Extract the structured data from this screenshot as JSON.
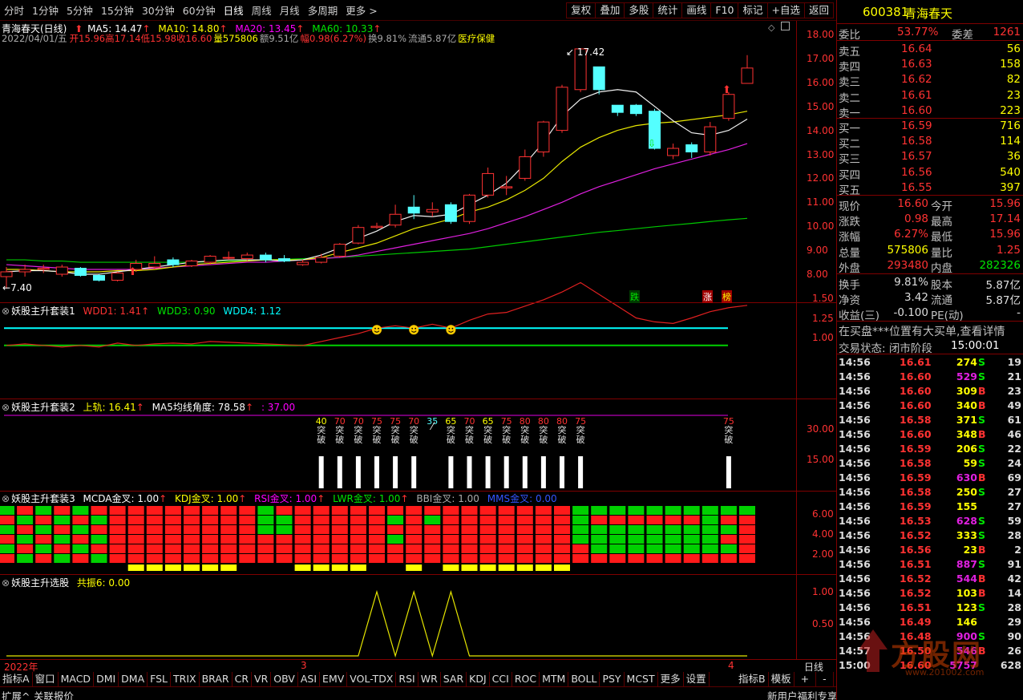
{
  "topbar": {
    "periods": [
      "分时",
      "1分钟",
      "5分钟",
      "15分钟",
      "30分钟",
      "60分钟",
      "日线",
      "周线",
      "月线",
      "多周期",
      "更多"
    ],
    "active_period": "日线",
    "more_arrow": "chevron-right-icon",
    "tools": [
      "复权",
      "叠加",
      "多股",
      "统计",
      "画线",
      "F10",
      "标记",
      "+自选",
      "返回"
    ]
  },
  "stock": {
    "code": "600381",
    "name": "青海春天"
  },
  "main_chart": {
    "title": "青海春天(日线)",
    "ma5": "MA5: 14.47",
    "ma10": "MA10: 14.80",
    "ma20": "MA20: 13.45",
    "ma60": "MA60: 10.33",
    "date": "2022/04/01/五",
    "open_l": "开",
    "open": "15.96",
    "high_l": "高",
    "high": "17.14",
    "low_l": "低",
    "low": "15.98",
    "close_l": "收",
    "close": "16.60",
    "vol_l": "量",
    "vol": "575806",
    "amt": "额9.51亿",
    "amp_l": "幅",
    "amp": "0.98(6.27%)",
    "turn": "换9.81%",
    "circ": "流通5.87亿",
    "sector": "医疗保健",
    "y_ticks": [
      "18.00",
      "17.00",
      "16.00",
      "15.00",
      "14.00",
      "13.00",
      "12.00",
      "11.00",
      "10.00",
      "9.00",
      "8.00"
    ],
    "max_label": "17.42",
    "min_label": "7.40",
    "tag_down": "跌",
    "tag_up": "涨",
    "tag_rank": "榜"
  },
  "panel1": {
    "title": "妖股主升套装1",
    "wdd1": "WDD1: 1.41",
    "wdd3": "WDD3: 0.90",
    "wdd4": "WDD4: 1.12",
    "y_ticks": [
      "1.50",
      "1.25",
      "1.00"
    ]
  },
  "panel2": {
    "title": "妖股主升套装2",
    "upper": "上轨: 16.41",
    "ma5_angle": "MA5均线角度: 78.58",
    "val": ": 37.00",
    "y_ticks": [
      "30.00",
      "15.00"
    ],
    "signals": [
      "40",
      "70",
      "70",
      "75",
      "75",
      "70",
      "35",
      "65",
      "70",
      "65",
      "75",
      "80",
      "80",
      "80",
      "75",
      "75"
    ],
    "break_word": "突破"
  },
  "panel3": {
    "title": "妖股主升套装3",
    "mcda": "MCDA金叉: 1.00",
    "kdj": "KDJ金叉: 1.00",
    "rsi": "RSI金叉: 1.00",
    "lwr": "LWR金叉: 1.00",
    "bbi": "BBI金叉: 1.00",
    "mms": "MMS金叉: 0.00",
    "y_ticks": [
      "6.00",
      "4.00",
      "2.00"
    ]
  },
  "panel4": {
    "title": "妖股主升选股",
    "resonance": "共振6: 0.00",
    "y_ticks": [
      "1.00",
      "0.50"
    ]
  },
  "xaxis": {
    "year": "2022年",
    "m3": "3",
    "m4": "4",
    "period": "日线"
  },
  "bottom_tabs": [
    "指标A",
    "窗口",
    "MACD",
    "DMI",
    "DMA",
    "FSL",
    "TRIX",
    "BRAR",
    "CR",
    "VR",
    "OBV",
    "ASI",
    "EMV",
    "VOL-TDX",
    "RSI",
    "WR",
    "SAR",
    "KDJ",
    "CCI",
    "ROC",
    "MTM",
    "BOLL",
    "PSY",
    "MCST",
    "更多",
    "设置"
  ],
  "bottom_right": [
    "指标B",
    "模板",
    "+",
    "-"
  ],
  "status": {
    "expand": "扩展^",
    "news": "关联报价",
    "promo": "新用户福利专享",
    "tabs": [
      "笔",
      "价",
      "细",
      "势",
      "联",
      "值",
      "主",
      "筹"
    ]
  },
  "orderbook": {
    "wb_l": "委比",
    "wb": "53.77%",
    "wc_l": "委差",
    "wc": "1261",
    "asks": [
      {
        "l": "卖五",
        "p": "16.64",
        "v": "56"
      },
      {
        "l": "卖四",
        "p": "16.63",
        "v": "158"
      },
      {
        "l": "卖三",
        "p": "16.62",
        "v": "82"
      },
      {
        "l": "卖二",
        "p": "16.61",
        "v": "23"
      },
      {
        "l": "卖一",
        "p": "16.60",
        "v": "223"
      }
    ],
    "bids": [
      {
        "l": "买一",
        "p": "16.59",
        "v": "716"
      },
      {
        "l": "买二",
        "p": "16.58",
        "v": "114"
      },
      {
        "l": "买三",
        "p": "16.57",
        "v": "36"
      },
      {
        "l": "买四",
        "p": "16.56",
        "v": "540"
      },
      {
        "l": "买五",
        "p": "16.55",
        "v": "397"
      }
    ]
  },
  "quote": [
    {
      "l1": "现价",
      "v1": "16.60",
      "l2": "今开",
      "v2": "15.96"
    },
    {
      "l1": "涨跌",
      "v1": "0.98",
      "l2": "最高",
      "v2": "17.14"
    },
    {
      "l1": "涨幅",
      "v1": "6.27%",
      "l2": "最低",
      "v2": "15.96"
    },
    {
      "l1": "总量",
      "v1": "575806",
      "l2": "量比",
      "v2": "1.25"
    },
    {
      "l1": "外盘",
      "v1": "293480",
      "l2": "内盘",
      "v2": "282326"
    }
  ],
  "quote2": [
    {
      "l1": "换手",
      "v1": "9.81%",
      "l2": "股本",
      "v2": "5.87亿"
    },
    {
      "l1": "净资",
      "v1": "3.42",
      "l2": "流通",
      "v2": "5.87亿"
    },
    {
      "l1": "收益(三)",
      "v1": "-0.100",
      "l2": "PE(动)",
      "v2": "-"
    }
  ],
  "notice": "在买盘***位置有大买单,查看详情",
  "trade_state": {
    "label": "交易状态: 闭市阶段",
    "time": "15:00:01"
  },
  "ticks": [
    {
      "t": "14:56",
      "p": "16.61",
      "v": "274",
      "d": "S",
      "n": "19"
    },
    {
      "t": "14:56",
      "p": "16.60",
      "v": "529",
      "d": "S",
      "n": "21"
    },
    {
      "t": "14:56",
      "p": "16.60",
      "v": "309",
      "d": "B",
      "n": "23"
    },
    {
      "t": "14:56",
      "p": "16.60",
      "v": "340",
      "d": "B",
      "n": "49"
    },
    {
      "t": "14:56",
      "p": "16.58",
      "v": "371",
      "d": "S",
      "n": "61"
    },
    {
      "t": "14:56",
      "p": "16.60",
      "v": "348",
      "d": "B",
      "n": "46"
    },
    {
      "t": "14:56",
      "p": "16.59",
      "v": "206",
      "d": "S",
      "n": "22"
    },
    {
      "t": "14:56",
      "p": "16.58",
      "v": "59",
      "d": "S",
      "n": "24"
    },
    {
      "t": "14:56",
      "p": "16.59",
      "v": "630",
      "d": "B",
      "n": "69"
    },
    {
      "t": "14:56",
      "p": "16.58",
      "v": "250",
      "d": "S",
      "n": "27"
    },
    {
      "t": "14:56",
      "p": "16.59",
      "v": "155",
      "d": "",
      "n": "27"
    },
    {
      "t": "14:56",
      "p": "16.53",
      "v": "628",
      "d": "S",
      "n": "59"
    },
    {
      "t": "14:56",
      "p": "16.52",
      "v": "333",
      "d": "S",
      "n": "28"
    },
    {
      "t": "14:56",
      "p": "16.56",
      "v": "23",
      "d": "B",
      "n": "2"
    },
    {
      "t": "14:56",
      "p": "16.51",
      "v": "887",
      "d": "S",
      "n": "91"
    },
    {
      "t": "14:56",
      "p": "16.52",
      "v": "544",
      "d": "B",
      "n": "42"
    },
    {
      "t": "14:56",
      "p": "16.52",
      "v": "103",
      "d": "B",
      "n": "14"
    },
    {
      "t": "14:56",
      "p": "16.51",
      "v": "123",
      "d": "S",
      "n": "28"
    },
    {
      "t": "14:56",
      "p": "16.49",
      "v": "146",
      "d": "",
      "n": "29"
    },
    {
      "t": "14:56",
      "p": "16.48",
      "v": "900",
      "d": "S",
      "n": "90"
    },
    {
      "t": "14:57",
      "p": "16.50",
      "v": "546",
      "d": "B",
      "n": "26"
    },
    {
      "t": "15:00",
      "p": "16.60",
      "v": "5757",
      "d": "",
      "n": "628"
    }
  ],
  "watermark": "方股网",
  "watermark_url": "www.201002.com",
  "chart_data": {
    "type": "candlestick",
    "candles": [
      [
        7.9,
        8.1,
        8.3,
        7.4
      ],
      [
        8.1,
        8.2,
        8.4,
        7.9
      ],
      [
        8.2,
        8.25,
        8.4,
        8.05
      ],
      [
        8.0,
        8.3,
        8.4,
        7.9
      ],
      [
        8.25,
        7.95,
        8.3,
        7.9
      ],
      [
        7.95,
        7.75,
        8.0,
        7.7
      ],
      [
        7.75,
        8.05,
        8.1,
        7.7
      ],
      [
        8.2,
        8.45,
        8.6,
        8.1
      ],
      [
        8.3,
        8.45,
        8.75,
        8.2
      ],
      [
        8.6,
        8.4,
        8.7,
        8.3
      ],
      [
        8.35,
        8.55,
        8.6,
        8.3
      ],
      [
        8.5,
        8.75,
        8.8,
        8.4
      ],
      [
        8.7,
        8.7,
        8.95,
        8.6
      ],
      [
        8.65,
        8.8,
        8.9,
        8.55
      ],
      [
        8.8,
        8.6,
        8.9,
        8.5
      ],
      [
        8.65,
        8.55,
        8.8,
        8.5
      ],
      [
        8.4,
        8.5,
        8.6,
        8.35
      ],
      [
        8.5,
        8.7,
        8.85,
        8.45
      ],
      [
        8.75,
        9.25,
        9.3,
        8.7
      ],
      [
        9.3,
        9.95,
        10.05,
        9.25
      ],
      [
        9.95,
        10.0,
        10.15,
        9.9
      ],
      [
        10.05,
        10.5,
        10.9,
        9.95
      ],
      [
        10.8,
        10.55,
        11.3,
        10.3
      ],
      [
        10.6,
        10.7,
        11.0,
        10.4
      ],
      [
        10.9,
        10.2,
        11.0,
        10.1
      ],
      [
        10.2,
        11.3,
        11.35,
        10.1
      ],
      [
        11.3,
        12.2,
        12.45,
        11.2
      ],
      [
        11.6,
        11.65,
        12.1,
        11.3
      ],
      [
        12.0,
        12.9,
        13.2,
        11.9
      ],
      [
        13.1,
        14.35,
        14.4,
        12.9
      ],
      [
        14.0,
        15.8,
        15.9,
        13.9
      ],
      [
        15.7,
        17.4,
        17.42,
        15.6
      ],
      [
        16.65,
        15.7,
        16.65,
        15.5
      ],
      [
        15.05,
        14.75,
        15.0,
        14.6
      ],
      [
        15.05,
        14.7,
        15.1,
        14.6
      ],
      [
        14.8,
        13.25,
        14.9,
        13.2
      ],
      [
        12.95,
        13.25,
        13.45,
        12.8
      ],
      [
        13.4,
        13.1,
        13.5,
        12.85
      ],
      [
        13.1,
        14.15,
        14.35,
        12.95
      ],
      [
        14.5,
        15.5,
        15.6,
        14.4
      ],
      [
        15.96,
        16.6,
        17.14,
        15.96
      ]
    ],
    "ma5": [
      8.1,
      8.15,
      8.15,
      8.1,
      8.0,
      8.0,
      8.1,
      8.2,
      8.3,
      8.4,
      8.5,
      8.55,
      8.6,
      8.6,
      8.6,
      8.55,
      8.6,
      8.8,
      9.1,
      9.5,
      9.8,
      10.2,
      10.45,
      10.4,
      10.5,
      10.9,
      11.3,
      11.8,
      12.6,
      13.5,
      14.6,
      15.3,
      15.6,
      15.7,
      15.6,
      15.0,
      14.4,
      13.9,
      13.8,
      14.0,
      14.47
    ],
    "ma10": [
      8.2,
      8.2,
      8.15,
      8.1,
      8.1,
      8.1,
      8.15,
      8.15,
      8.2,
      8.3,
      8.4,
      8.45,
      8.5,
      8.55,
      8.6,
      8.6,
      8.6,
      8.7,
      8.9,
      9.1,
      9.3,
      9.6,
      9.9,
      10.1,
      10.3,
      10.6,
      10.8,
      11.1,
      11.5,
      12.0,
      12.7,
      13.3,
      13.7,
      14.0,
      14.2,
      14.3,
      14.35,
      14.45,
      14.55,
      14.65,
      14.8
    ],
    "ma20": [
      8.4,
      8.35,
      8.3,
      8.25,
      8.2,
      8.2,
      8.2,
      8.2,
      8.25,
      8.3,
      8.35,
      8.4,
      8.45,
      8.5,
      8.5,
      8.55,
      8.6,
      8.65,
      8.7,
      8.8,
      8.95,
      9.1,
      9.25,
      9.4,
      9.55,
      9.7,
      9.9,
      10.15,
      10.4,
      10.7,
      11.0,
      11.35,
      11.65,
      11.9,
      12.15,
      12.4,
      12.6,
      12.8,
      13.0,
      13.2,
      13.45
    ],
    "ma60": [
      8.6,
      8.6,
      8.55,
      8.55,
      8.5,
      8.5,
      8.5,
      8.5,
      8.5,
      8.5,
      8.5,
      8.52,
      8.55,
      8.58,
      8.6,
      8.62,
      8.65,
      8.68,
      8.7,
      8.75,
      8.8,
      8.85,
      8.9,
      8.95,
      9.0,
      9.05,
      9.15,
      9.25,
      9.35,
      9.45,
      9.55,
      9.65,
      9.75,
      9.82,
      9.9,
      9.98,
      10.05,
      10.12,
      10.2,
      10.27,
      10.33
    ],
    "panel1_wdd1": [
      0.9,
      0.92,
      0.9,
      0.88,
      0.9,
      0.88,
      0.93,
      0.9,
      0.92,
      0.93,
      0.92,
      0.95,
      0.94,
      0.93,
      0.92,
      0.91,
      0.9,
      0.95,
      1.0,
      1.05,
      1.12,
      1.15,
      1.12,
      1.17,
      1.12,
      1.22,
      1.3,
      1.32,
      1.4,
      1.48,
      1.58,
      1.7,
      1.55,
      1.4,
      1.25,
      1.2,
      1.18,
      1.25,
      1.33,
      1.38,
      1.41
    ],
    "panel1_wdd3": 0.9,
    "panel1_wdd4": 1.12,
    "smiles_idx": [
      20,
      22,
      24
    ],
    "panel2_bars_idx": [
      17,
      18,
      19,
      20,
      21,
      22,
      24,
      25,
      26,
      27,
      28,
      29,
      30,
      31,
      39
    ],
    "panel2_labels_idx": [
      17,
      18,
      19,
      20,
      21,
      22,
      23,
      24,
      25,
      26,
      27,
      28,
      29,
      30,
      31,
      39
    ],
    "panel3_cols": [
      "GRGRGR",
      "RGRGRG",
      "GRGRGR",
      "RGRGRG",
      "GRGRGR",
      "RGRGRG",
      "RRRRRR",
      "RRRRRR",
      "RRRRRR",
      "RRRRRR",
      "RRRRRR",
      "RRRRRR",
      "RRRRRR",
      "RRRRRR",
      "GGGRRR",
      "RGGRRR",
      "RRRRRR",
      "RRRRRR",
      "RRRRRR",
      "RRRRRR",
      "RRRRRR",
      "RGRGRR",
      "RRRRRR",
      "RGRRRR",
      "RRRRRR",
      "RRRRRR",
      "RRRRRR",
      "RRRRRR",
      "RRRRRR",
      "RRRRRR",
      "RRRRRR",
      "GGGGRR",
      "GRGGGR",
      "GRGGGR",
      "GRGGGR",
      "GRGGGR",
      "GRGGGR",
      "GRGGGR",
      "GGGGGR",
      "GRGRGR",
      "GRRRRR"
    ],
    "panel3_yellow_idx": [
      7,
      8,
      9,
      10,
      11,
      12,
      16,
      17,
      18,
      19,
      22,
      24,
      25,
      26,
      27,
      28,
      29,
      30
    ],
    "panel4_series": [
      0,
      0,
      0,
      0,
      0,
      0,
      0,
      0,
      0,
      0,
      0,
      0,
      0,
      0,
      0,
      0,
      0,
      0,
      0,
      0,
      1,
      0,
      1,
      0,
      1,
      0,
      0,
      0,
      0,
      0,
      0,
      0,
      0,
      0,
      0,
      0,
      0,
      0,
      0,
      0,
      0
    ]
  }
}
